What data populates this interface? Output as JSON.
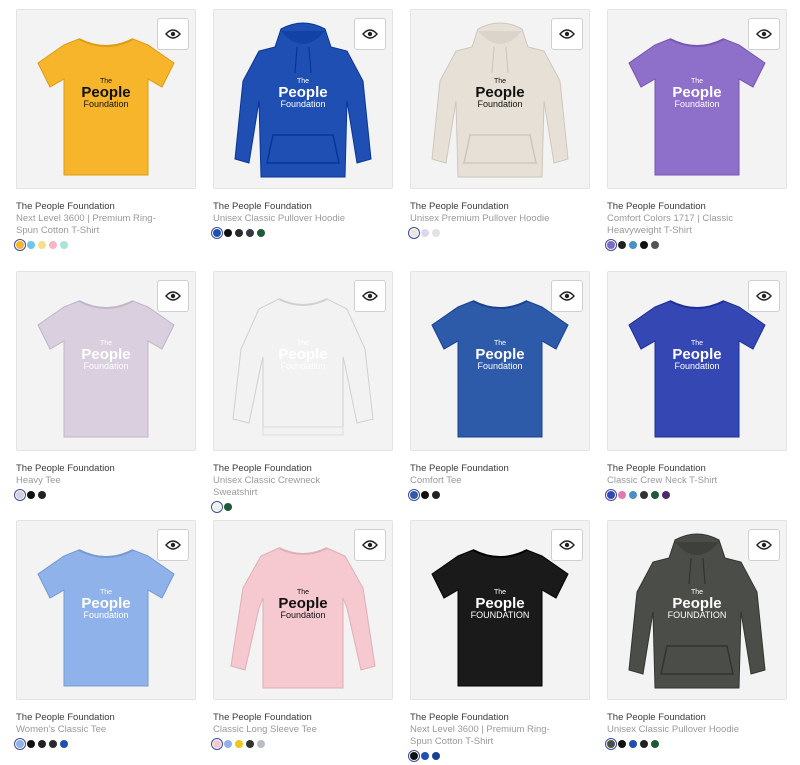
{
  "products": [
    {
      "title": "The People Foundation",
      "subtitle": "Next Level 3600 | Premium Ring-Spun Cotton T-Shirt",
      "type": "tee",
      "color": "#f6b52a",
      "print": "#111111",
      "brand": [
        "The",
        "People",
        "Foundation"
      ],
      "swatches": [
        "#f6b52a",
        "#6ec6ea",
        "#f4e08a",
        "#f6b7c3",
        "#a8e4d8"
      ]
    },
    {
      "title": "The People Foundation",
      "subtitle": "Unisex Classic Pullover Hoodie",
      "type": "hoodie",
      "color": "#1f4fb3",
      "print": "#ffffff",
      "brand": [
        "The",
        "People",
        "Foundation"
      ],
      "swatches": [
        "#1f4fb3",
        "#111111",
        "#2b2b2b",
        "#333a44",
        "#1d5a38"
      ]
    },
    {
      "title": "The People Foundation",
      "subtitle": "Unisex Premium Pullover Hoodie",
      "type": "hoodie",
      "color": "#e6e0d6",
      "print": "#111111",
      "brand": [
        "The",
        "People",
        "Foundation"
      ],
      "swatches": [
        "#ebe6df",
        "#ded6ee",
        "#e2e2e2"
      ]
    },
    {
      "title": "The People Foundation",
      "subtitle": "Comfort Colors 1717 | Classic Heavyweight T-Shirt",
      "type": "tee",
      "color": "#8e6fca",
      "print": "#ffffff",
      "brand": [
        "The",
        "People",
        "Foundation"
      ],
      "swatches": [
        "#7d6ac6",
        "#222222",
        "#4a90c4",
        "#111111",
        "#555555"
      ]
    },
    {
      "title": "The People Foundation",
      "subtitle": "Heavy Tee",
      "type": "tee",
      "color": "#d9cfde",
      "print": "#ffffff",
      "brand": [
        "The",
        "People",
        "Foundation"
      ],
      "swatches": [
        "#d5cfe2",
        "#111111",
        "#222222"
      ]
    },
    {
      "title": "The People Foundation",
      "subtitle": "Unisex Classic Crewneck Sweatshirt",
      "type": "crew",
      "color": "#f2f2f2",
      "print": "#ffffff",
      "brand": [
        "The",
        "People",
        "Foundation"
      ],
      "swatches": [
        "#f0f0f0",
        "#1d5a38"
      ]
    },
    {
      "title": "The People Foundation",
      "subtitle": "Comfort Tee",
      "type": "tee",
      "color": "#2e5aaa",
      "print": "#ffffff",
      "brand": [
        "The",
        "People",
        "Foundation"
      ],
      "swatches": [
        "#2e5aaa",
        "#111111",
        "#222222"
      ]
    },
    {
      "title": "The People Foundation",
      "subtitle": "Classic Crew Neck T-Shirt",
      "type": "tee",
      "color": "#3547b3",
      "print": "#ffffff",
      "brand": [
        "The",
        "People",
        "Foundation"
      ],
      "swatches": [
        "#3547b3",
        "#e07ab0",
        "#4a90c4",
        "#333333",
        "#1d5a38",
        "#4a2a6a"
      ]
    },
    {
      "title": "The People Foundation",
      "subtitle": "Women's Classic Tee",
      "type": "tee",
      "color": "#8fb2ea",
      "print": "#ffffff",
      "brand": [
        "The",
        "People",
        "Foundation"
      ],
      "swatches": [
        "#8fb2ea",
        "#111111",
        "#222222",
        "#2a2a2a",
        "#1f4fb3"
      ]
    },
    {
      "title": "The People Foundation",
      "subtitle": "Classic Long Sleeve Tee",
      "type": "long",
      "color": "#f6c8cf",
      "print": "#111111",
      "brand": [
        "The",
        "People",
        "Foundation"
      ],
      "swatches": [
        "#f6c8cf",
        "#8fb2ea",
        "#f0c420",
        "#333333",
        "#b8bcc6"
      ]
    },
    {
      "title": "The People Foundation",
      "subtitle": "Next Level 3600 | Premium Ring-Spun Cotton T-Shirt",
      "type": "tee",
      "color": "#1a1a1a",
      "print": "#ffffff",
      "brand": [
        "The",
        "People",
        "FOUNDATION"
      ],
      "swatches": [
        "#111111",
        "#1f4fb3",
        "#1a3f8f"
      ]
    },
    {
      "title": "The People Foundation",
      "subtitle": "Unisex Classic Pullover Hoodie",
      "type": "hoodie",
      "color": "#4a4d48",
      "print": "#ffffff",
      "brand": [
        "The",
        "People",
        "FOUNDATION"
      ],
      "swatches": [
        "#4a4d48",
        "#111111",
        "#1f4fb3",
        "#222222",
        "#1d5a38"
      ]
    }
  ]
}
